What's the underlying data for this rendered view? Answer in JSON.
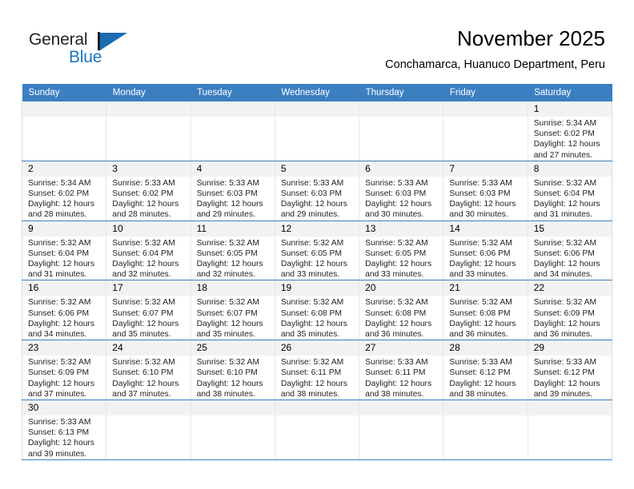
{
  "brand": {
    "name_top": "General",
    "name_bottom": "Blue",
    "mark": "triangle-flag-icon",
    "color_primary": "#1b75bb",
    "color_text": "#231f20"
  },
  "header": {
    "title": "November 2025",
    "location": "Conchamarca, Huanuco Department, Peru"
  },
  "calendar": {
    "accent_color": "#3c7fc1",
    "daynum_band_color": "#f2f2f2",
    "weekday_headers": [
      "Sunday",
      "Monday",
      "Tuesday",
      "Wednesday",
      "Thursday",
      "Friday",
      "Saturday"
    ],
    "weeks": [
      [
        {
          "day": "",
          "empty": true
        },
        {
          "day": "",
          "empty": true
        },
        {
          "day": "",
          "empty": true
        },
        {
          "day": "",
          "empty": true
        },
        {
          "day": "",
          "empty": true
        },
        {
          "day": "",
          "empty": true
        },
        {
          "day": "1",
          "sunrise": "Sunrise: 5:34 AM",
          "sunset": "Sunset: 6:02 PM",
          "daylight_line1": "Daylight: 12 hours",
          "daylight_line2": "and 27 minutes."
        }
      ],
      [
        {
          "day": "2",
          "sunrise": "Sunrise: 5:34 AM",
          "sunset": "Sunset: 6:02 PM",
          "daylight_line1": "Daylight: 12 hours",
          "daylight_line2": "and 28 minutes."
        },
        {
          "day": "3",
          "sunrise": "Sunrise: 5:33 AM",
          "sunset": "Sunset: 6:02 PM",
          "daylight_line1": "Daylight: 12 hours",
          "daylight_line2": "and 28 minutes."
        },
        {
          "day": "4",
          "sunrise": "Sunrise: 5:33 AM",
          "sunset": "Sunset: 6:03 PM",
          "daylight_line1": "Daylight: 12 hours",
          "daylight_line2": "and 29 minutes."
        },
        {
          "day": "5",
          "sunrise": "Sunrise: 5:33 AM",
          "sunset": "Sunset: 6:03 PM",
          "daylight_line1": "Daylight: 12 hours",
          "daylight_line2": "and 29 minutes."
        },
        {
          "day": "6",
          "sunrise": "Sunrise: 5:33 AM",
          "sunset": "Sunset: 6:03 PM",
          "daylight_line1": "Daylight: 12 hours",
          "daylight_line2": "and 30 minutes."
        },
        {
          "day": "7",
          "sunrise": "Sunrise: 5:33 AM",
          "sunset": "Sunset: 6:03 PM",
          "daylight_line1": "Daylight: 12 hours",
          "daylight_line2": "and 30 minutes."
        },
        {
          "day": "8",
          "sunrise": "Sunrise: 5:32 AM",
          "sunset": "Sunset: 6:04 PM",
          "daylight_line1": "Daylight: 12 hours",
          "daylight_line2": "and 31 minutes."
        }
      ],
      [
        {
          "day": "9",
          "sunrise": "Sunrise: 5:32 AM",
          "sunset": "Sunset: 6:04 PM",
          "daylight_line1": "Daylight: 12 hours",
          "daylight_line2": "and 31 minutes."
        },
        {
          "day": "10",
          "sunrise": "Sunrise: 5:32 AM",
          "sunset": "Sunset: 6:04 PM",
          "daylight_line1": "Daylight: 12 hours",
          "daylight_line2": "and 32 minutes."
        },
        {
          "day": "11",
          "sunrise": "Sunrise: 5:32 AM",
          "sunset": "Sunset: 6:05 PM",
          "daylight_line1": "Daylight: 12 hours",
          "daylight_line2": "and 32 minutes."
        },
        {
          "day": "12",
          "sunrise": "Sunrise: 5:32 AM",
          "sunset": "Sunset: 6:05 PM",
          "daylight_line1": "Daylight: 12 hours",
          "daylight_line2": "and 33 minutes."
        },
        {
          "day": "13",
          "sunrise": "Sunrise: 5:32 AM",
          "sunset": "Sunset: 6:05 PM",
          "daylight_line1": "Daylight: 12 hours",
          "daylight_line2": "and 33 minutes."
        },
        {
          "day": "14",
          "sunrise": "Sunrise: 5:32 AM",
          "sunset": "Sunset: 6:06 PM",
          "daylight_line1": "Daylight: 12 hours",
          "daylight_line2": "and 33 minutes."
        },
        {
          "day": "15",
          "sunrise": "Sunrise: 5:32 AM",
          "sunset": "Sunset: 6:06 PM",
          "daylight_line1": "Daylight: 12 hours",
          "daylight_line2": "and 34 minutes."
        }
      ],
      [
        {
          "day": "16",
          "sunrise": "Sunrise: 5:32 AM",
          "sunset": "Sunset: 6:06 PM",
          "daylight_line1": "Daylight: 12 hours",
          "daylight_line2": "and 34 minutes."
        },
        {
          "day": "17",
          "sunrise": "Sunrise: 5:32 AM",
          "sunset": "Sunset: 6:07 PM",
          "daylight_line1": "Daylight: 12 hours",
          "daylight_line2": "and 35 minutes."
        },
        {
          "day": "18",
          "sunrise": "Sunrise: 5:32 AM",
          "sunset": "Sunset: 6:07 PM",
          "daylight_line1": "Daylight: 12 hours",
          "daylight_line2": "and 35 minutes."
        },
        {
          "day": "19",
          "sunrise": "Sunrise: 5:32 AM",
          "sunset": "Sunset: 6:08 PM",
          "daylight_line1": "Daylight: 12 hours",
          "daylight_line2": "and 35 minutes."
        },
        {
          "day": "20",
          "sunrise": "Sunrise: 5:32 AM",
          "sunset": "Sunset: 6:08 PM",
          "daylight_line1": "Daylight: 12 hours",
          "daylight_line2": "and 36 minutes."
        },
        {
          "day": "21",
          "sunrise": "Sunrise: 5:32 AM",
          "sunset": "Sunset: 6:08 PM",
          "daylight_line1": "Daylight: 12 hours",
          "daylight_line2": "and 36 minutes."
        },
        {
          "day": "22",
          "sunrise": "Sunrise: 5:32 AM",
          "sunset": "Sunset: 6:09 PM",
          "daylight_line1": "Daylight: 12 hours",
          "daylight_line2": "and 36 minutes."
        }
      ],
      [
        {
          "day": "23",
          "sunrise": "Sunrise: 5:32 AM",
          "sunset": "Sunset: 6:09 PM",
          "daylight_line1": "Daylight: 12 hours",
          "daylight_line2": "and 37 minutes."
        },
        {
          "day": "24",
          "sunrise": "Sunrise: 5:32 AM",
          "sunset": "Sunset: 6:10 PM",
          "daylight_line1": "Daylight: 12 hours",
          "daylight_line2": "and 37 minutes."
        },
        {
          "day": "25",
          "sunrise": "Sunrise: 5:32 AM",
          "sunset": "Sunset: 6:10 PM",
          "daylight_line1": "Daylight: 12 hours",
          "daylight_line2": "and 38 minutes."
        },
        {
          "day": "26",
          "sunrise": "Sunrise: 5:32 AM",
          "sunset": "Sunset: 6:11 PM",
          "daylight_line1": "Daylight: 12 hours",
          "daylight_line2": "and 38 minutes."
        },
        {
          "day": "27",
          "sunrise": "Sunrise: 5:33 AM",
          "sunset": "Sunset: 6:11 PM",
          "daylight_line1": "Daylight: 12 hours",
          "daylight_line2": "and 38 minutes."
        },
        {
          "day": "28",
          "sunrise": "Sunrise: 5:33 AM",
          "sunset": "Sunset: 6:12 PM",
          "daylight_line1": "Daylight: 12 hours",
          "daylight_line2": "and 38 minutes."
        },
        {
          "day": "29",
          "sunrise": "Sunrise: 5:33 AM",
          "sunset": "Sunset: 6:12 PM",
          "daylight_line1": "Daylight: 12 hours",
          "daylight_line2": "and 39 minutes."
        }
      ],
      [
        {
          "day": "30",
          "sunrise": "Sunrise: 5:33 AM",
          "sunset": "Sunset: 6:13 PM",
          "daylight_line1": "Daylight: 12 hours",
          "daylight_line2": "and 39 minutes."
        },
        {
          "day": "",
          "empty": true
        },
        {
          "day": "",
          "empty": true
        },
        {
          "day": "",
          "empty": true
        },
        {
          "day": "",
          "empty": true
        },
        {
          "day": "",
          "empty": true
        },
        {
          "day": "",
          "empty": true
        }
      ]
    ]
  }
}
